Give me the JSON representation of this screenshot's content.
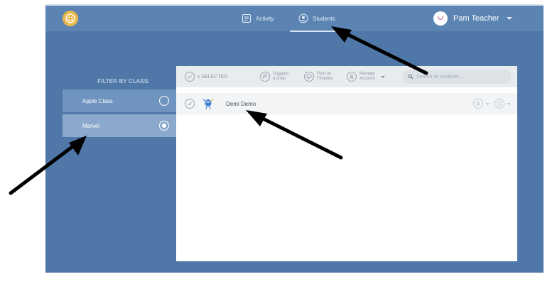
{
  "topbar": {
    "logo_icon": "classdojo-monster-logo-icon",
    "tabs": [
      {
        "label": "Activity",
        "icon": "activity-list-icon"
      },
      {
        "label": "Students",
        "icon": "students-person-icon",
        "active": true
      }
    ],
    "user": {
      "name": "Pam Teacher",
      "avatar_icon": "teacher-avatar-icon"
    }
  },
  "filter": {
    "title": "FILTER BY CLASS:",
    "classes": [
      {
        "name": "Apple Class",
        "selected": false
      },
      {
        "name": "Marvel",
        "selected": true
      }
    ]
  },
  "toolbar": {
    "selected_text": "s SELECTED",
    "suggest_goal": "Suggest a Goal",
    "suggest_goal_line1": "Suggest",
    "suggest_goal_line2": "a Goal",
    "post_timeline_line1": "Post on",
    "post_timeline_line2": "Timeline",
    "manage_account_line1": "Manage",
    "manage_account_line2": "Account",
    "search_placeholder": "Search all students ..."
  },
  "students": [
    {
      "name": "Demi Demo",
      "avatar_icon": "monster-avatar-icon"
    }
  ],
  "colors": {
    "app_background": "#4f78a8",
    "topbar": "#5b84b3",
    "class_row": "#6e94bf",
    "class_row_selected": "#8aa9cc",
    "logo": "#e9b84a",
    "annotation_arrow": "#000000"
  }
}
